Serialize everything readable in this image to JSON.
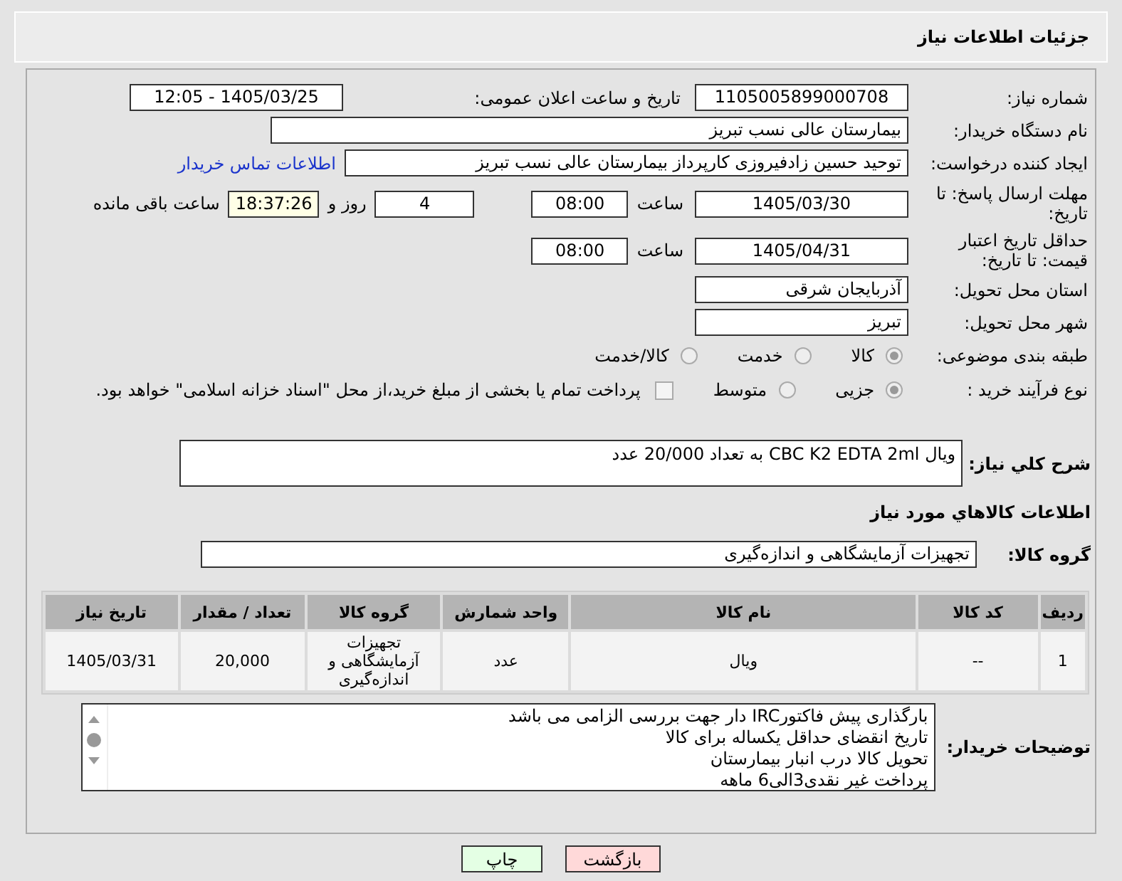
{
  "header": {
    "title": "جزئیات اطلاعات نیاز"
  },
  "need_number": {
    "label": "شماره نیاز:",
    "value": "1105005899000708"
  },
  "announce_datetime": {
    "label": "تاریخ و ساعت اعلان عمومی:",
    "value": "1405/03/25 - 12:05"
  },
  "buyer_org": {
    "label": "نام دستگاه خریدار:",
    "value": "بیمارستان عالی نسب تبریز"
  },
  "requester": {
    "label": "ایجاد کننده درخواست:",
    "value": "توحید حسین زادفیروزی کارپرداز بیمارستان عالی نسب تبریز",
    "link": "اطلاعات تماس خریدار"
  },
  "response_deadline": {
    "label": "مهلت ارسال پاسخ: تا تاریخ:",
    "date": "1405/03/30",
    "time_label": "ساعت",
    "time": "08:00",
    "days": "4",
    "days_label": "روز و",
    "remaining": "18:37:26",
    "remaining_label": "ساعت باقی مانده"
  },
  "price_validity": {
    "label": "حداقل تاریخ اعتبار قیمت: تا تاریخ:",
    "date": "1405/04/31",
    "time_label": "ساعت",
    "time": "08:00"
  },
  "province": {
    "label": "استان محل تحویل:",
    "value": "آذربایجان شرقی"
  },
  "city": {
    "label": "شهر محل تحویل:",
    "value": "تبریز"
  },
  "category": {
    "label": "طبقه بندی موضوعی:",
    "options": [
      {
        "label": "کالا",
        "selected": true
      },
      {
        "label": "خدمت",
        "selected": false
      },
      {
        "label": "کالا/خدمت",
        "selected": false
      }
    ]
  },
  "purchase_type": {
    "label": "نوع فرآیند خرید :",
    "options": [
      {
        "label": "جزیی",
        "selected": true
      },
      {
        "label": "متوسط",
        "selected": false
      }
    ],
    "treasury": {
      "label": "پرداخت تمام یا بخشی از مبلغ خرید،از محل \"اسناد خزانه اسلامی\" خواهد بود.",
      "checked": false
    }
  },
  "description": {
    "label": "شرح کلي نياز:",
    "value": "ویال CBC K2 EDTA 2ml به تعداد 20/000 عدد"
  },
  "goods_heading": "اطلاعات کالاهاي مورد نياز",
  "goods_group": {
    "label": "گروه کالا:",
    "value": "تجهیزات آزمایشگاهی و اندازه‌گیری"
  },
  "table": {
    "columns": [
      "ردیف",
      "کد کالا",
      "نام کالا",
      "واحد شمارش",
      "گروه کالا",
      "تعداد / مقدار",
      "تاریخ نیاز"
    ],
    "rows": [
      [
        "1",
        "--",
        "ویال",
        "عدد",
        "تجهیزات آزمایشگاهی و اندازه‌گیری",
        "20,000",
        "1405/03/31"
      ]
    ]
  },
  "buyer_notes": {
    "label": "توضیحات خریدار:",
    "lines": [
      "بارگذاری پیش فاکتورIRC دار جهت بررسی الزامی می باشد",
      "تاریخ انقضای حداقل یکساله برای کالا",
      "تحویل کالا درب انبار بیمارستان",
      "پرداخت غیر نقدی3الی6 ماهه"
    ]
  },
  "buttons": [
    {
      "label": "بازگشت",
      "kind": "back"
    },
    {
      "label": "چاپ",
      "kind": "print"
    }
  ]
}
